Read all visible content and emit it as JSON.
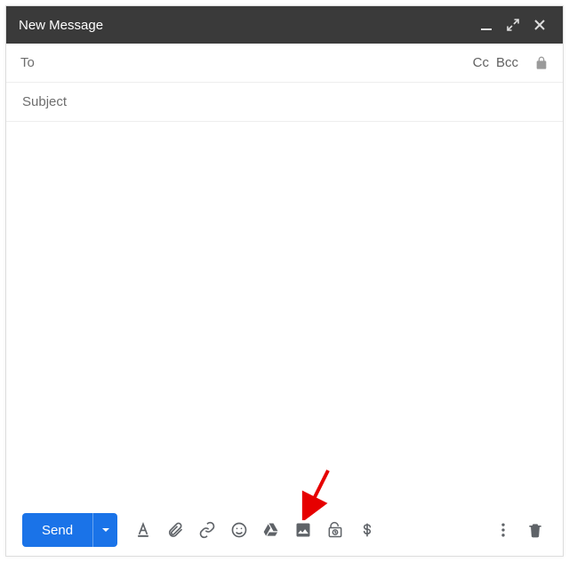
{
  "titlebar": {
    "title": "New Message"
  },
  "recipients": {
    "to_label": "To",
    "cc_label": "Cc",
    "bcc_label": "Bcc"
  },
  "subject": {
    "placeholder": "Subject",
    "value": ""
  },
  "compose": {
    "send_label": "Send"
  }
}
